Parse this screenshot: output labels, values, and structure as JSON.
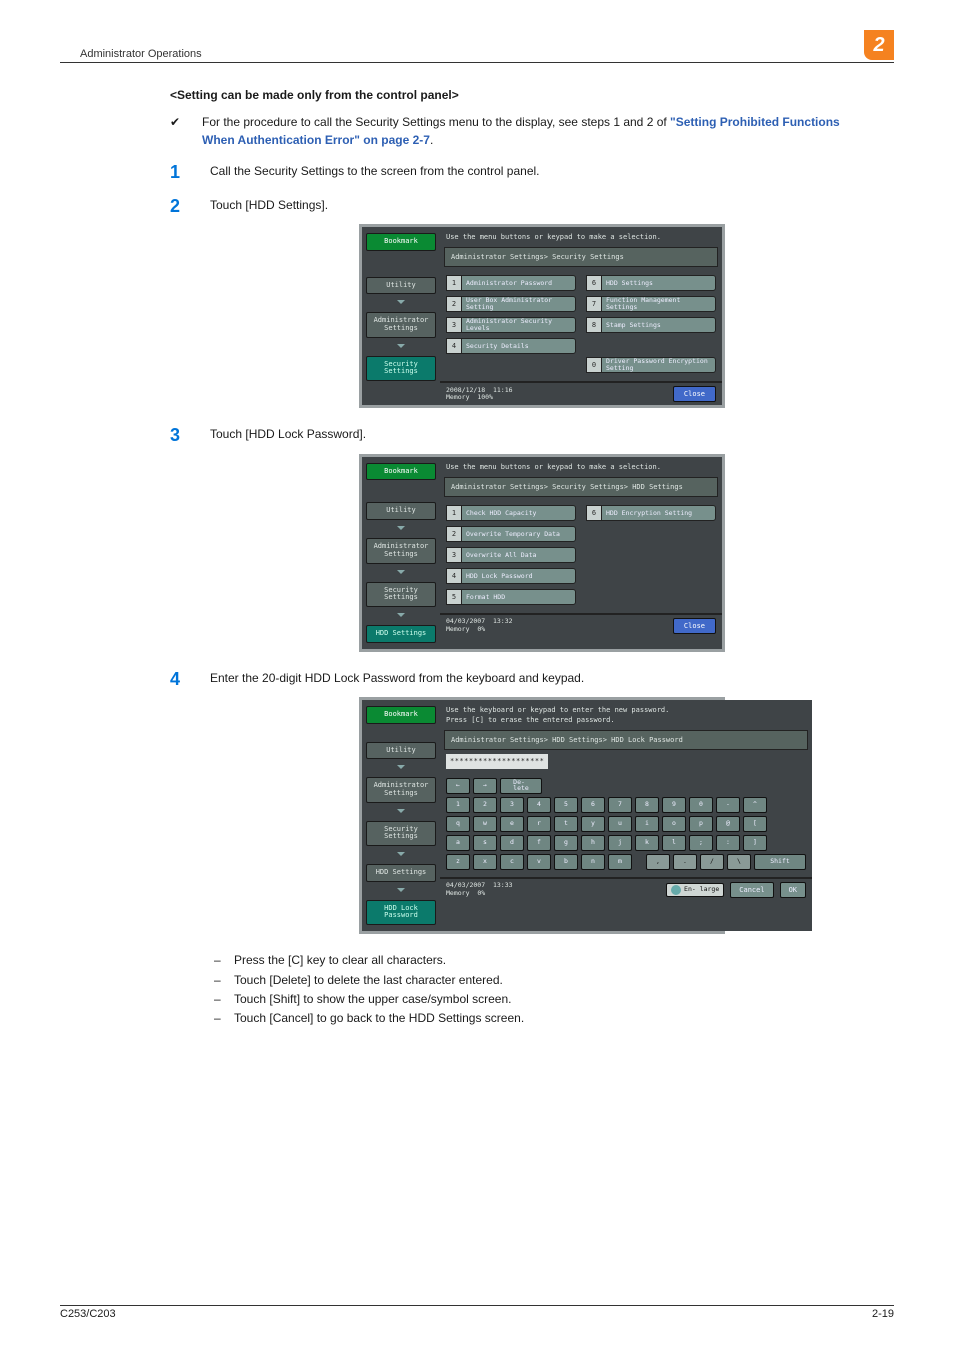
{
  "header": {
    "section_title": "Administrator Operations",
    "chapter_num": "2"
  },
  "subhead": "<Setting can be made only from the control panel>",
  "checknote": {
    "mark": "✔",
    "text_before": "For the procedure to call the Security Settings menu to the display, see steps 1 and 2 of ",
    "link": "\"Setting Prohibited Functions When Authentication Error\" on page 2-7",
    "text_after": "."
  },
  "steps": {
    "s1": "Call the Security Settings to the screen from the control panel.",
    "s2": "Touch [HDD Settings].",
    "s3": "Touch [HDD Lock Password].",
    "s4": "Enter the 20-digit HDD Lock Password from the keyboard and keypad.",
    "s4_notes": [
      "Press the [C] key to clear all characters.",
      "Touch [Delete] to delete the last character entered.",
      "Touch [Shift] to show the upper case/symbol screen.",
      "Touch [Cancel] to go back to the HDD Settings screen."
    ]
  },
  "panel_common": {
    "bookmark": "Bookmark",
    "utility": "Utility",
    "admin_settings": "Administrator\nSettings",
    "security_settings": "Security\nSettings",
    "hdd_settings": "HDD Settings",
    "hdd_lock_pw": "HDD Lock\nPassword",
    "close": "Close",
    "cancel": "Cancel",
    "ok": "OK",
    "memory_label": "Memory"
  },
  "panel1": {
    "hint": "Use the menu buttons or keypad to make a selection.",
    "crumb": "Administrator Settings> Security Settings",
    "left": [
      {
        "n": "1",
        "t": "Administrator Password"
      },
      {
        "n": "2",
        "t": "User Box Administrator Setting"
      },
      {
        "n": "3",
        "t": "Administrator Security Levels"
      },
      {
        "n": "4",
        "t": "Security Details"
      }
    ],
    "right": [
      {
        "n": "6",
        "t": "HDD Settings"
      },
      {
        "n": "7",
        "t": "Function Management Settings"
      },
      {
        "n": "8",
        "t": "Stamp Settings"
      },
      {
        "n": "0",
        "t": "Driver Password Encryption Setting"
      }
    ],
    "date": "2008/12/18",
    "time": "11:16",
    "mem": "100%"
  },
  "panel2": {
    "hint": "Use the menu buttons or keypad to make a selection.",
    "crumb": "Administrator Settings> Security Settings> HDD Settings",
    "left": [
      {
        "n": "1",
        "t": "Check HDD Capacity"
      },
      {
        "n": "2",
        "t": "Overwrite Temporary Data"
      },
      {
        "n": "3",
        "t": "Overwrite All Data"
      },
      {
        "n": "4",
        "t": "HDD Lock Password"
      },
      {
        "n": "5",
        "t": "Format HDD"
      }
    ],
    "right": [
      {
        "n": "6",
        "t": "HDD Encryption Setting"
      }
    ],
    "date": "04/03/2007",
    "time": "13:32",
    "mem": "0%"
  },
  "panel3": {
    "hint1": "Use the keyboard or keypad to enter the new password.",
    "hint2": "Press [C] to erase the entered password.",
    "crumb": "Administrator Settings> HDD Settings> HDD Lock Password",
    "pw_mask": "********************",
    "delete_btn": "De-\nlete",
    "row_nums": [
      "1",
      "2",
      "3",
      "4",
      "5",
      "6",
      "7",
      "8",
      "9",
      "0",
      "-",
      "^"
    ],
    "row_q": [
      "q",
      "w",
      "e",
      "r",
      "t",
      "y",
      "u",
      "i",
      "o",
      "p",
      "@",
      "["
    ],
    "row_a": [
      "a",
      "s",
      "d",
      "f",
      "g",
      "h",
      "j",
      "k",
      "l",
      ";",
      ":",
      "]"
    ],
    "row_z": [
      "z",
      "x",
      "c",
      "v",
      "b",
      "n",
      "m",
      ",",
      ".",
      "/",
      "\\"
    ],
    "shift": "Shift",
    "enlarge": "En- large",
    "date": "04/03/2007",
    "time": "13:33",
    "mem": "0%"
  },
  "footer": {
    "model": "C253/C203",
    "page": "2-19"
  }
}
